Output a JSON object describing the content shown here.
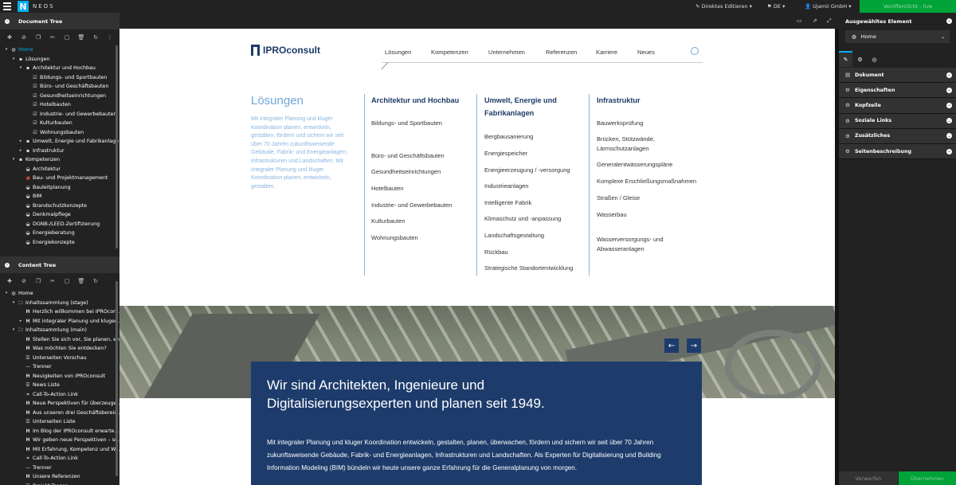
{
  "topbar": {
    "brand": "NEOS",
    "edit_mode": "Direktes Editieren",
    "language": "DE",
    "user": "Ujamii GmbH",
    "publish": "Veröffentlicht - live"
  },
  "document_tree": {
    "title": "Document Tree",
    "items": [
      {
        "label": "Home",
        "icon": "globe",
        "depth": 0,
        "arrow": "▾",
        "active": true
      },
      {
        "label": "Lösungen",
        "icon": "page",
        "depth": 1,
        "arrow": "▾"
      },
      {
        "label": "Architektur und Hochbau",
        "icon": "page",
        "depth": 2,
        "arrow": "▾"
      },
      {
        "label": "Bildungs- und Sportbauten",
        "icon": "check",
        "depth": 3
      },
      {
        "label": "Büro- und Geschäftsbauten",
        "icon": "check",
        "depth": 3
      },
      {
        "label": "Gesundheitseinrichtungen",
        "icon": "check",
        "depth": 3
      },
      {
        "label": "Hotelbauten",
        "icon": "check",
        "depth": 3
      },
      {
        "label": "Industrie- und Gewerbebauten",
        "icon": "check",
        "depth": 3
      },
      {
        "label": "Kulturbauten",
        "icon": "check",
        "depth": 3
      },
      {
        "label": "Wohnungsbauten",
        "icon": "check",
        "depth": 3
      },
      {
        "label": "Umwelt, Energie und Fabrikanlage",
        "icon": "page",
        "depth": 2,
        "arrow": "▸"
      },
      {
        "label": "Infrastruktur",
        "icon": "page",
        "depth": 2,
        "arrow": "▸"
      },
      {
        "label": "Kompetenzen",
        "icon": "page",
        "depth": 1,
        "arrow": "▾"
      },
      {
        "label": "Architektur",
        "icon": "circle",
        "depth": 2
      },
      {
        "label": "Bau- und Projektmanagement",
        "icon": "circle-red",
        "depth": 2
      },
      {
        "label": "Bauleitplanung",
        "icon": "circle",
        "depth": 2
      },
      {
        "label": "BIM",
        "icon": "circle",
        "depth": 2
      },
      {
        "label": "Brandschutzkonzepte",
        "icon": "circle",
        "depth": 2
      },
      {
        "label": "Denkmalpflege",
        "icon": "circle",
        "depth": 2
      },
      {
        "label": "DGNB-/LEED-Zertifizierung",
        "icon": "circle",
        "depth": 2
      },
      {
        "label": "Energieberatung",
        "icon": "circle",
        "depth": 2
      },
      {
        "label": "Energiekonzepte",
        "icon": "circle",
        "depth": 2
      }
    ]
  },
  "content_tree": {
    "title": "Content Tree",
    "items": [
      {
        "label": "Home",
        "icon": "globe",
        "depth": 0,
        "arrow": "▾"
      },
      {
        "label": "Inhaltssammlung (stage)",
        "icon": "folder",
        "depth": 1,
        "arrow": "▾"
      },
      {
        "label": "Herzlich willkommen bei IPROcon...",
        "icon": "H",
        "depth": 2
      },
      {
        "label": "Mit integraler Planung und kluger...",
        "icon": "H",
        "depth": 2,
        "arrow": "▸"
      },
      {
        "label": "Inhaltssammlung (main)",
        "icon": "folder",
        "depth": 1,
        "arrow": "▾"
      },
      {
        "label": "Stellen Sie sich vor, Sie planen, en...",
        "icon": "H",
        "depth": 2
      },
      {
        "label": "Was möchten Sie entdecken?",
        "icon": "H",
        "depth": 2
      },
      {
        "label": "Unterseiten Vorschau",
        "icon": "list",
        "depth": 2
      },
      {
        "label": "Trenner",
        "icon": "minus",
        "depth": 2
      },
      {
        "label": "Neuigkeiten von IPROconsult",
        "icon": "H",
        "depth": 2
      },
      {
        "label": "News Liste",
        "icon": "list",
        "depth": 2
      },
      {
        "label": "Call-To-Action Link",
        "icon": "link",
        "depth": 2
      },
      {
        "label": "Neue Perspektiven für überzeuge...",
        "icon": "H",
        "depth": 2
      },
      {
        "label": "Aus unseren drei Geschäftsbereic...",
        "icon": "H",
        "depth": 2
      },
      {
        "label": "Unterseiten Liste",
        "icon": "list",
        "depth": 2
      },
      {
        "label": "Im Blog der IPROconsult erwarte...",
        "icon": "H",
        "depth": 2
      },
      {
        "label": "Wir geben neue Perspektiven – se...",
        "icon": "H",
        "depth": 2
      },
      {
        "label": "Mit Erfahrung, Kompetenz und W...",
        "icon": "H",
        "depth": 2
      },
      {
        "label": "Call-To-Action Link",
        "icon": "link",
        "depth": 2
      },
      {
        "label": "Trenner",
        "icon": "minus",
        "depth": 2
      },
      {
        "label": "Unsere Referenzen",
        "icon": "H",
        "depth": 2
      },
      {
        "label": "Projekt-Teaser",
        "icon": "list",
        "depth": 2
      }
    ]
  },
  "inspector": {
    "title": "Ausgewähltes Element",
    "selected": "Home",
    "groups": [
      "Dokument",
      "Eigenschaften",
      "Kopfzeile",
      "Soziale Links",
      "Zusätzliches",
      "Seitenbeschreibung"
    ],
    "discard": "Verwerfen",
    "apply": "Übernehmen"
  },
  "site": {
    "logo": "IPROconsult",
    "nav": [
      "Lösungen",
      "Kompetenzen",
      "Unternehmen",
      "Referenzen",
      "Karriere",
      "Neues"
    ],
    "intro_title": "Lösungen",
    "intro_text": "Mit integraler Planung und kluger Koordination planen, entwickeln, gestalten, fördern und sichern wir seit über 70 Jahren zukunftsweisende Gebäude, Fabrik- und Energieanlagen, Infrastrukturen und Landschaften. Mit integraler Planung und kluger Koordination planen, entwickeln, gestalten.",
    "columns": [
      {
        "title": "Architektur und Hochbau",
        "links": [
          "Bildungs- und Sportbauten",
          "Büro- und Geschäftsbauten",
          "Gesundheitseinrichtungen",
          "Hotelbauten",
          "Industrie- und Gewerbebauten",
          "Kulturbauten",
          "Wohnungsbauten"
        ]
      },
      {
        "title": "Umwelt, Energie und Fabrikanlagen",
        "links": [
          "Bergbausanierung",
          "Energiespeicher",
          "Energieerzeugung / -versorgung",
          "Industrieanlagen",
          "Intelligente Fabrik",
          "Klimaschutz und -anpassung",
          "Landschaftsgestaltung",
          "Rückbau",
          "Strategische Standortentwicklung"
        ]
      },
      {
        "title": "Infrastruktur",
        "links": [
          "Bauwerksprüfung",
          "Brücken, Stützwände, Lärmschutzanlagen",
          "Generalentwässerungspläne",
          "Komplexe Erschließungsmaßnahmen",
          "Straßen / Gleise",
          "Wasserbau",
          "Wasserversorgungs- und Abwasseranlagen"
        ]
      }
    ],
    "hero_heading": "Wir sind Architekten, Ingenieure und Digitalisierungsexperten und planen seit 1949.",
    "hero_text": "Mit integraler Planung und kluger Koordination entwickeln, gestalten, planen, überwachen, fördern und sichern wir seit über 70 Jahren zukunftsweisende Gebäude, Fabrik- und Energieanlagen, Infrastrukturen und Landschaften. Als Experten für Digitalisierung und Building Information Modeling (BIM) bündeln wir heute unsere ganze Erfahrung für die Generalplanung von morgen."
  },
  "colors": {
    "accent": "#00adee",
    "publish": "#00a338",
    "brand_blue": "#1d3b67",
    "hero_box": "#1d3c6b",
    "light_blue": "#6fa6d9"
  }
}
